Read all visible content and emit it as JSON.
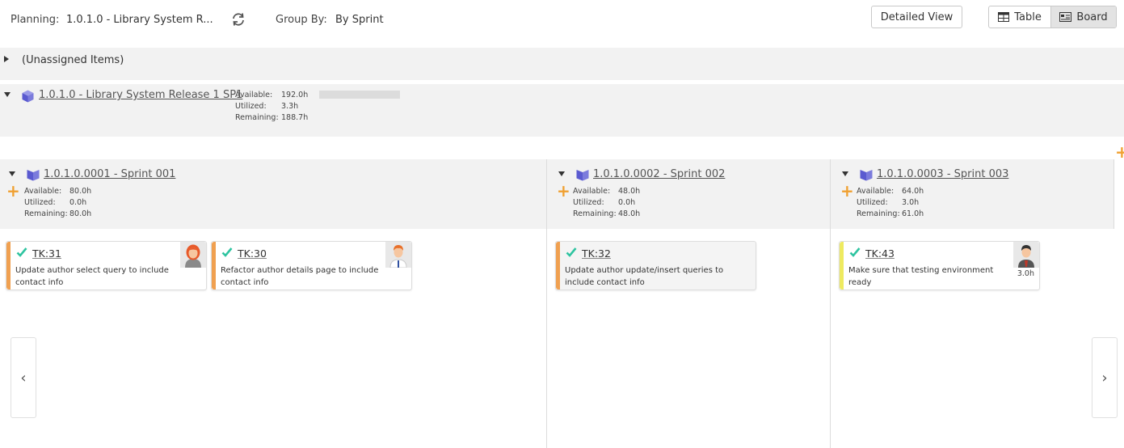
{
  "toolbar": {
    "planning_label": "Planning:",
    "planning_value": "1.0.1.0 - Library System R...",
    "group_label": "Group By:",
    "group_value": "By Sprint",
    "detailed_view": "Detailed View",
    "table_label": "Table",
    "board_label": "Board"
  },
  "unassigned": {
    "label": "(Unassigned Items)"
  },
  "release": {
    "name": "1.0.1.0 - Library System Release 1 SP1",
    "available_label": "Available:",
    "available": "192.0h",
    "utilized_label": "Utilized:",
    "utilized": "3.3h",
    "remaining_label": "Remaining:",
    "remaining": "188.7h"
  },
  "sprints": [
    {
      "name": "1.0.1.0.0001 - Sprint 001",
      "available_label": "Available:",
      "available": "80.0h",
      "utilized_label": "Utilized:",
      "utilized": "0.0h",
      "remaining_label": "Remaining:",
      "remaining": "80.0h"
    },
    {
      "name": "1.0.1.0.0002 - Sprint 002",
      "available_label": "Available:",
      "available": "48.0h",
      "utilized_label": "Utilized:",
      "utilized": "0.0h",
      "remaining_label": "Remaining:",
      "remaining": "48.0h"
    },
    {
      "name": "1.0.1.0.0003 - Sprint 003",
      "available_label": "Available:",
      "available": "64.0h",
      "utilized_label": "Utilized:",
      "utilized": "3.0h",
      "remaining_label": "Remaining:",
      "remaining": "61.0h"
    }
  ],
  "cards": [
    {
      "id": "TK:31",
      "desc": "Update author select query to include contact info",
      "bar_color": "#f0a050",
      "hours": ""
    },
    {
      "id": "TK:30",
      "desc": "Refactor author details page to include contact info",
      "bar_color": "#f0a050",
      "hours": ""
    },
    {
      "id": "TK:32",
      "desc": "Update author update/insert queries to include contact info",
      "bar_color": "#f0a050",
      "hours": ""
    },
    {
      "id": "TK:43",
      "desc": "Make sure that testing environment ready",
      "bar_color": "#eeea60",
      "hours": "3.0h"
    }
  ],
  "nav": {
    "prev": "‹",
    "next": "›"
  },
  "colors": {
    "accent_plus": "#f0a030",
    "check": "#2ec4a0",
    "cube": "#6b6bd6"
  },
  "icons": [
    "refresh-icon",
    "table-icon",
    "board-icon",
    "release-cube-icon",
    "sprint-cube-icon",
    "check-icon",
    "add-icon",
    "avatar-icon"
  ]
}
